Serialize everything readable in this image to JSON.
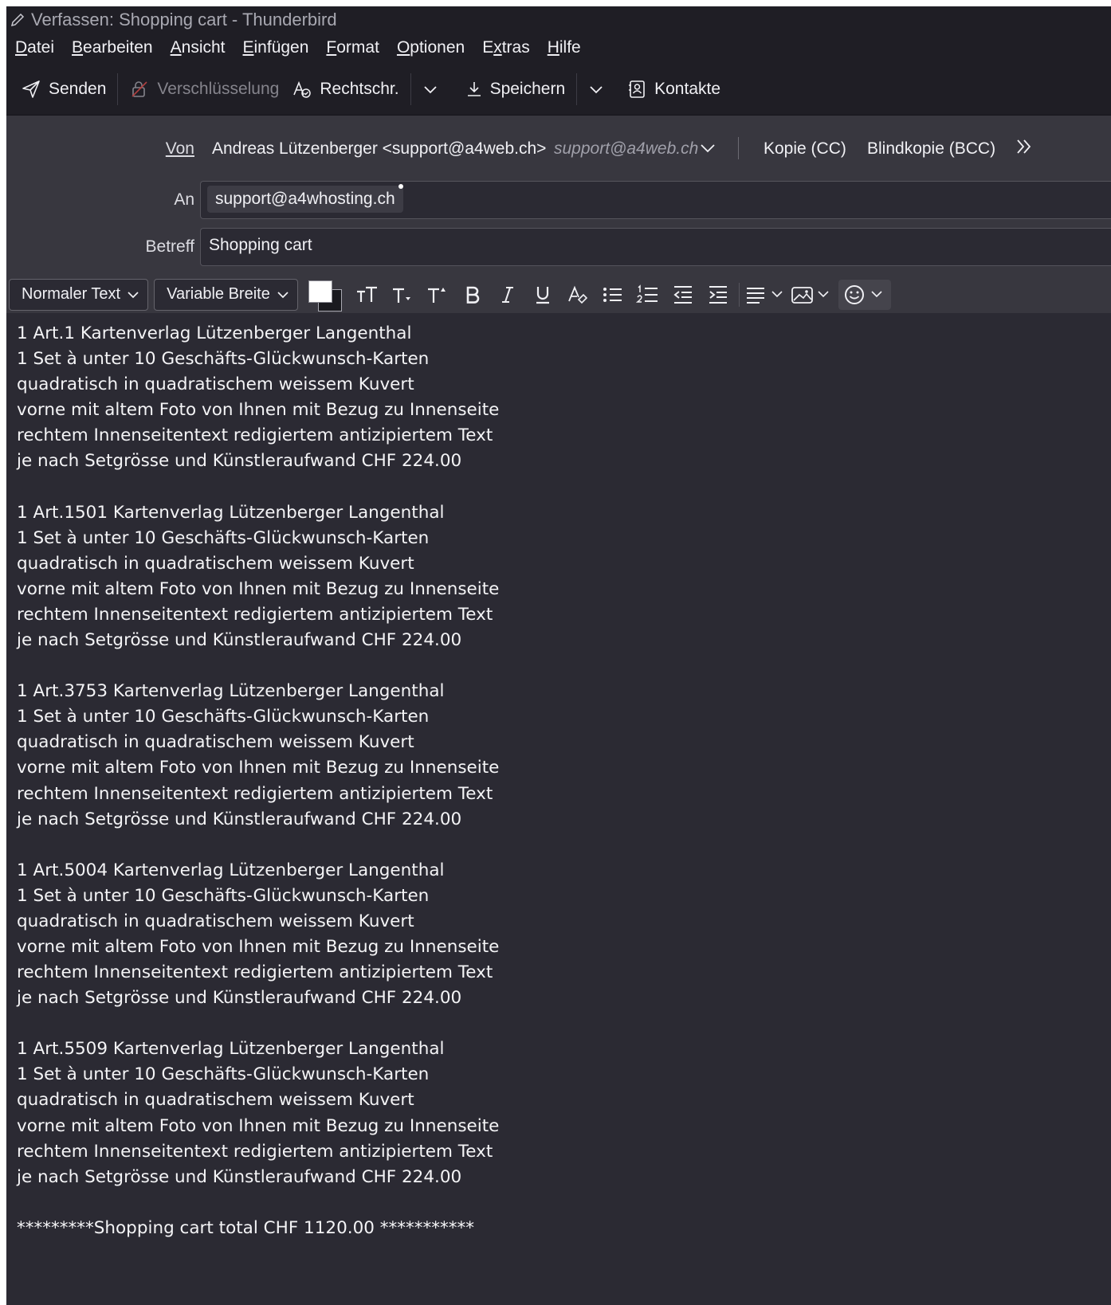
{
  "window": {
    "title": "Verfassen: Shopping cart - Thunderbird"
  },
  "menubar": {
    "items": [
      {
        "pre": "",
        "u": "D",
        "post": "atei"
      },
      {
        "pre": "",
        "u": "B",
        "post": "earbeiten"
      },
      {
        "pre": "",
        "u": "A",
        "post": "nsicht"
      },
      {
        "pre": "",
        "u": "E",
        "post": "infügen"
      },
      {
        "pre": "",
        "u": "F",
        "post": "ormat"
      },
      {
        "pre": "",
        "u": "O",
        "post": "ptionen"
      },
      {
        "pre": "E",
        "u": "x",
        "post": "tras"
      },
      {
        "pre": "",
        "u": "H",
        "post": "ilfe"
      }
    ]
  },
  "toolbar": {
    "send": "Senden",
    "encryption": "Verschlüsselung",
    "spelling": "Rechtschr.",
    "save": "Speichern",
    "contacts": "Kontakte"
  },
  "header": {
    "from_label": "Von",
    "from_value": "Andreas Lützenberger <support@a4web.ch>",
    "from_alias": "support@a4web.ch",
    "cc": "Kopie (CC)",
    "bcc": "Blindkopie (BCC)",
    "to_label": "An",
    "to_recipient": "support@a4whosting.ch",
    "subject_label": "Betreff",
    "subject_value": "Shopping cart"
  },
  "format": {
    "paragraph": "Normaler Text",
    "font": "Variable Breite"
  },
  "body": {
    "blocks": [
      [
        "1 Art.1 Kartenverlag Lützenberger Langenthal",
        "1 Set à unter 10 Geschäfts-Glückwunsch-Karten",
        "quadratisch in quadratischem weissem Kuvert",
        "vorne mit altem Foto von Ihnen mit Bezug zu Innenseite",
        "rechtem Innenseitentext redigiertem antizipiertem Text",
        "je nach Setgrösse und Künstleraufwand CHF 224.00"
      ],
      [
        "1 Art.1501 Kartenverlag Lützenberger Langenthal",
        "1 Set à unter 10 Geschäfts-Glückwunsch-Karten",
        "quadratisch in quadratischem weissem Kuvert",
        "vorne mit altem Foto von Ihnen mit Bezug zu Innenseite",
        "rechtem Innenseitentext redigiertem antizipiertem Text",
        "je nach Setgrösse und Künstleraufwand CHF 224.00"
      ],
      [
        "1 Art.3753 Kartenverlag Lützenberger Langenthal",
        "1 Set à unter 10 Geschäfts-Glückwunsch-Karten",
        "quadratisch in quadratischem weissem Kuvert",
        "vorne mit altem Foto von Ihnen mit Bezug zu Innenseite",
        "rechtem Innenseitentext redigiertem antizipiertem Text",
        "je nach Setgrösse und Künstleraufwand CHF 224.00"
      ],
      [
        "1 Art.5004 Kartenverlag Lützenberger Langenthal",
        "1 Set à unter 10 Geschäfts-Glückwunsch-Karten",
        "quadratisch in quadratischem weissem Kuvert",
        "vorne mit altem Foto von Ihnen mit Bezug zu Innenseite",
        "rechtem Innenseitentext redigiertem antizipiertem Text",
        "je nach Setgrösse und Künstleraufwand CHF 224.00"
      ],
      [
        "1 Art.5509 Kartenverlag Lützenberger Langenthal",
        "1 Set à unter 10 Geschäfts-Glückwunsch-Karten",
        "quadratisch in quadratischem weissem Kuvert",
        "vorne mit altem Foto von Ihnen mit Bezug zu Innenseite",
        "rechtem Innenseitentext redigiertem antizipiertem Text",
        "je nach Setgrösse und Künstleraufwand CHF 224.00"
      ]
    ],
    "total": "*********Shopping cart total CHF 1120.00 ***********"
  },
  "colors": {
    "background": "#2b2a33",
    "chrome": "#1f1e25",
    "header": "#38373f",
    "text": "#f0f0f4"
  }
}
